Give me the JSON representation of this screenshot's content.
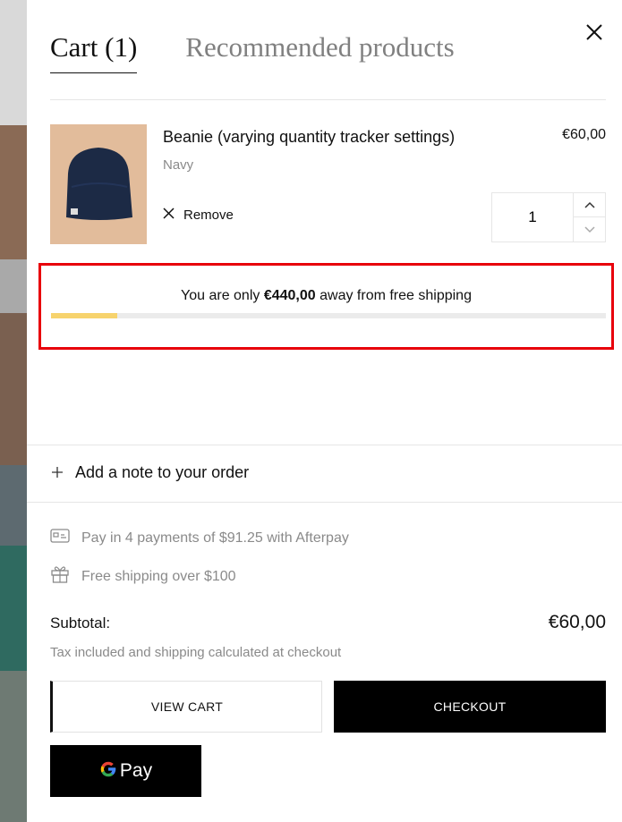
{
  "tabs": [
    {
      "label": "Cart (1)",
      "active": true
    },
    {
      "label": "Recommended products",
      "active": false
    }
  ],
  "cart_item": {
    "title": "Beanie (varying quantity tracker settings)",
    "price": "€60,00",
    "variant": "Navy",
    "remove_label": "Remove",
    "quantity": "1"
  },
  "shipping": {
    "prefix": "You are only ",
    "amount": "€440,00",
    "suffix": " away from free shipping",
    "progress": 0.12,
    "bar_color": "#f7d36d"
  },
  "note": {
    "label": "Add a note to your order"
  },
  "perks": [
    {
      "icon": "credit-card-icon",
      "text": "Pay in 4 payments of $91.25 with Afterpay"
    },
    {
      "icon": "gift-icon",
      "text": "Free shipping over $100"
    }
  ],
  "summary": {
    "subtotal_label": "Subtotal:",
    "subtotal_value": "€60,00",
    "tax_note": "Tax included and shipping calculated at checkout"
  },
  "buttons": {
    "view_cart": "VIEW CART",
    "checkout": "CHECKOUT",
    "gpay": "Pay"
  },
  "colors": {
    "highlight_border": "#e8000b",
    "checkout_bg": "#000000"
  }
}
